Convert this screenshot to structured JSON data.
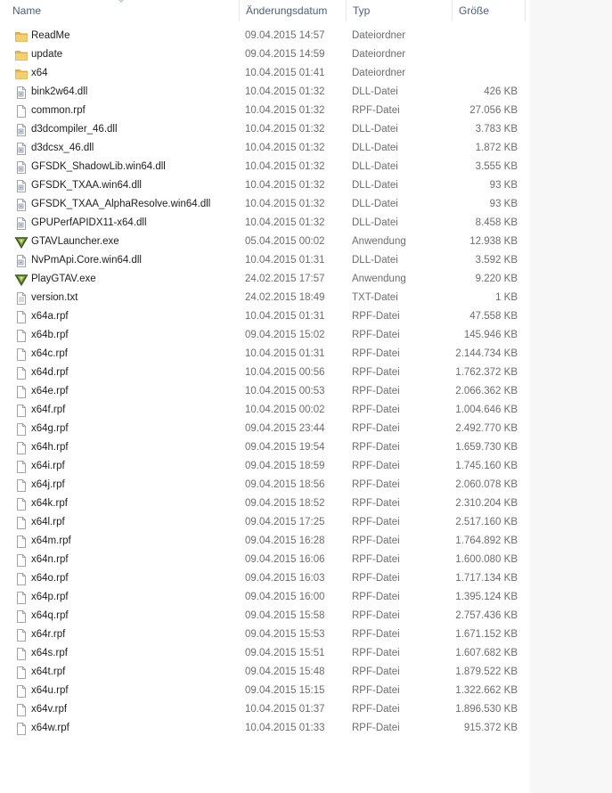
{
  "columns": {
    "name": "Name",
    "date": "Änderungsdatum",
    "type": "Typ",
    "size": "Größe"
  },
  "files": [
    {
      "name": "ReadMe",
      "date": "09.04.2015 14:57",
      "type": "Dateiordner",
      "size": "",
      "icon": "folder-icon"
    },
    {
      "name": "update",
      "date": "09.04.2015 14:59",
      "type": "Dateiordner",
      "size": "",
      "icon": "folder-icon"
    },
    {
      "name": "x64",
      "date": "10.04.2015 01:41",
      "type": "Dateiordner",
      "size": "",
      "icon": "folder-icon"
    },
    {
      "name": "bink2w64.dll",
      "date": "10.04.2015 01:32",
      "type": "DLL-Datei",
      "size": "426 KB",
      "icon": "dll-file-icon"
    },
    {
      "name": "common.rpf",
      "date": "10.04.2015 01:32",
      "type": "RPF-Datei",
      "size": "27.056 KB",
      "icon": "file-icon"
    },
    {
      "name": "d3dcompiler_46.dll",
      "date": "10.04.2015 01:32",
      "type": "DLL-Datei",
      "size": "3.783 KB",
      "icon": "dll-file-icon"
    },
    {
      "name": "d3dcsx_46.dll",
      "date": "10.04.2015 01:32",
      "type": "DLL-Datei",
      "size": "1.872 KB",
      "icon": "dll-file-icon"
    },
    {
      "name": "GFSDK_ShadowLib.win64.dll",
      "date": "10.04.2015 01:32",
      "type": "DLL-Datei",
      "size": "3.555 KB",
      "icon": "dll-file-icon"
    },
    {
      "name": "GFSDK_TXAA.win64.dll",
      "date": "10.04.2015 01:32",
      "type": "DLL-Datei",
      "size": "93 KB",
      "icon": "dll-file-icon"
    },
    {
      "name": "GFSDK_TXAA_AlphaResolve.win64.dll",
      "date": "10.04.2015 01:32",
      "type": "DLL-Datei",
      "size": "93 KB",
      "icon": "dll-file-icon"
    },
    {
      "name": "GPUPerfAPIDX11-x64.dll",
      "date": "10.04.2015 01:32",
      "type": "DLL-Datei",
      "size": "8.458 KB",
      "icon": "dll-file-icon"
    },
    {
      "name": "GTAVLauncher.exe",
      "date": "05.04.2015 00:02",
      "type": "Anwendung",
      "size": "12.938 KB",
      "icon": "gtav-app-icon"
    },
    {
      "name": "NvPmApi.Core.win64.dll",
      "date": "10.04.2015 01:31",
      "type": "DLL-Datei",
      "size": "3.592 KB",
      "icon": "dll-file-icon"
    },
    {
      "name": "PlayGTAV.exe",
      "date": "24.02.2015 17:57",
      "type": "Anwendung",
      "size": "9.220 KB",
      "icon": "gtav-app-icon"
    },
    {
      "name": "version.txt",
      "date": "24.02.2015 18:49",
      "type": "TXT-Datei",
      "size": "1 KB",
      "icon": "text-file-icon"
    },
    {
      "name": "x64a.rpf",
      "date": "10.04.2015 01:31",
      "type": "RPF-Datei",
      "size": "47.558 KB",
      "icon": "file-icon"
    },
    {
      "name": "x64b.rpf",
      "date": "09.04.2015 15:02",
      "type": "RPF-Datei",
      "size": "145.946 KB",
      "icon": "file-icon"
    },
    {
      "name": "x64c.rpf",
      "date": "10.04.2015 01:31",
      "type": "RPF-Datei",
      "size": "2.144.734 KB",
      "icon": "file-icon"
    },
    {
      "name": "x64d.rpf",
      "date": "10.04.2015 00:56",
      "type": "RPF-Datei",
      "size": "1.762.372 KB",
      "icon": "file-icon"
    },
    {
      "name": "x64e.rpf",
      "date": "10.04.2015 00:53",
      "type": "RPF-Datei",
      "size": "2.066.362 KB",
      "icon": "file-icon"
    },
    {
      "name": "x64f.rpf",
      "date": "10.04.2015 00:02",
      "type": "RPF-Datei",
      "size": "1.004.646 KB",
      "icon": "file-icon"
    },
    {
      "name": "x64g.rpf",
      "date": "09.04.2015 23:44",
      "type": "RPF-Datei",
      "size": "2.492.770 KB",
      "icon": "file-icon"
    },
    {
      "name": "x64h.rpf",
      "date": "09.04.2015 19:54",
      "type": "RPF-Datei",
      "size": "1.659.730 KB",
      "icon": "file-icon"
    },
    {
      "name": "x64i.rpf",
      "date": "09.04.2015 18:59",
      "type": "RPF-Datei",
      "size": "1.745.160 KB",
      "icon": "file-icon"
    },
    {
      "name": "x64j.rpf",
      "date": "09.04.2015 18:56",
      "type": "RPF-Datei",
      "size": "2.060.078 KB",
      "icon": "file-icon"
    },
    {
      "name": "x64k.rpf",
      "date": "09.04.2015 18:52",
      "type": "RPF-Datei",
      "size": "2.310.204 KB",
      "icon": "file-icon"
    },
    {
      "name": "x64l.rpf",
      "date": "09.04.2015 17:25",
      "type": "RPF-Datei",
      "size": "2.517.160 KB",
      "icon": "file-icon"
    },
    {
      "name": "x64m.rpf",
      "date": "09.04.2015 16:28",
      "type": "RPF-Datei",
      "size": "1.764.892 KB",
      "icon": "file-icon"
    },
    {
      "name": "x64n.rpf",
      "date": "09.04.2015 16:06",
      "type": "RPF-Datei",
      "size": "1.600.080 KB",
      "icon": "file-icon"
    },
    {
      "name": "x64o.rpf",
      "date": "09.04.2015 16:03",
      "type": "RPF-Datei",
      "size": "1.717.134 KB",
      "icon": "file-icon"
    },
    {
      "name": "x64p.rpf",
      "date": "09.04.2015 16:00",
      "type": "RPF-Datei",
      "size": "1.395.124 KB",
      "icon": "file-icon"
    },
    {
      "name": "x64q.rpf",
      "date": "09.04.2015 15:58",
      "type": "RPF-Datei",
      "size": "2.757.436 KB",
      "icon": "file-icon"
    },
    {
      "name": "x64r.rpf",
      "date": "09.04.2015 15:53",
      "type": "RPF-Datei",
      "size": "1.671.152 KB",
      "icon": "file-icon"
    },
    {
      "name": "x64s.rpf",
      "date": "09.04.2015 15:51",
      "type": "RPF-Datei",
      "size": "1.607.682 KB",
      "icon": "file-icon"
    },
    {
      "name": "x64t.rpf",
      "date": "09.04.2015 15:48",
      "type": "RPF-Datei",
      "size": "1.879.522 KB",
      "icon": "file-icon"
    },
    {
      "name": "x64u.rpf",
      "date": "09.04.2015 15:15",
      "type": "RPF-Datei",
      "size": "1.322.662 KB",
      "icon": "file-icon"
    },
    {
      "name": "x64v.rpf",
      "date": "10.04.2015 01:37",
      "type": "RPF-Datei",
      "size": "1.896.530 KB",
      "icon": "file-icon"
    },
    {
      "name": "x64w.rpf",
      "date": "10.04.2015 01:33",
      "type": "RPF-Datei",
      "size": "915.372 KB",
      "icon": "file-icon"
    }
  ],
  "colors": {
    "header_text": "#4c607a",
    "folder": "#e8b74a",
    "detail_text": "#6d6d6d",
    "gtav_green": "#5a7a2c"
  }
}
